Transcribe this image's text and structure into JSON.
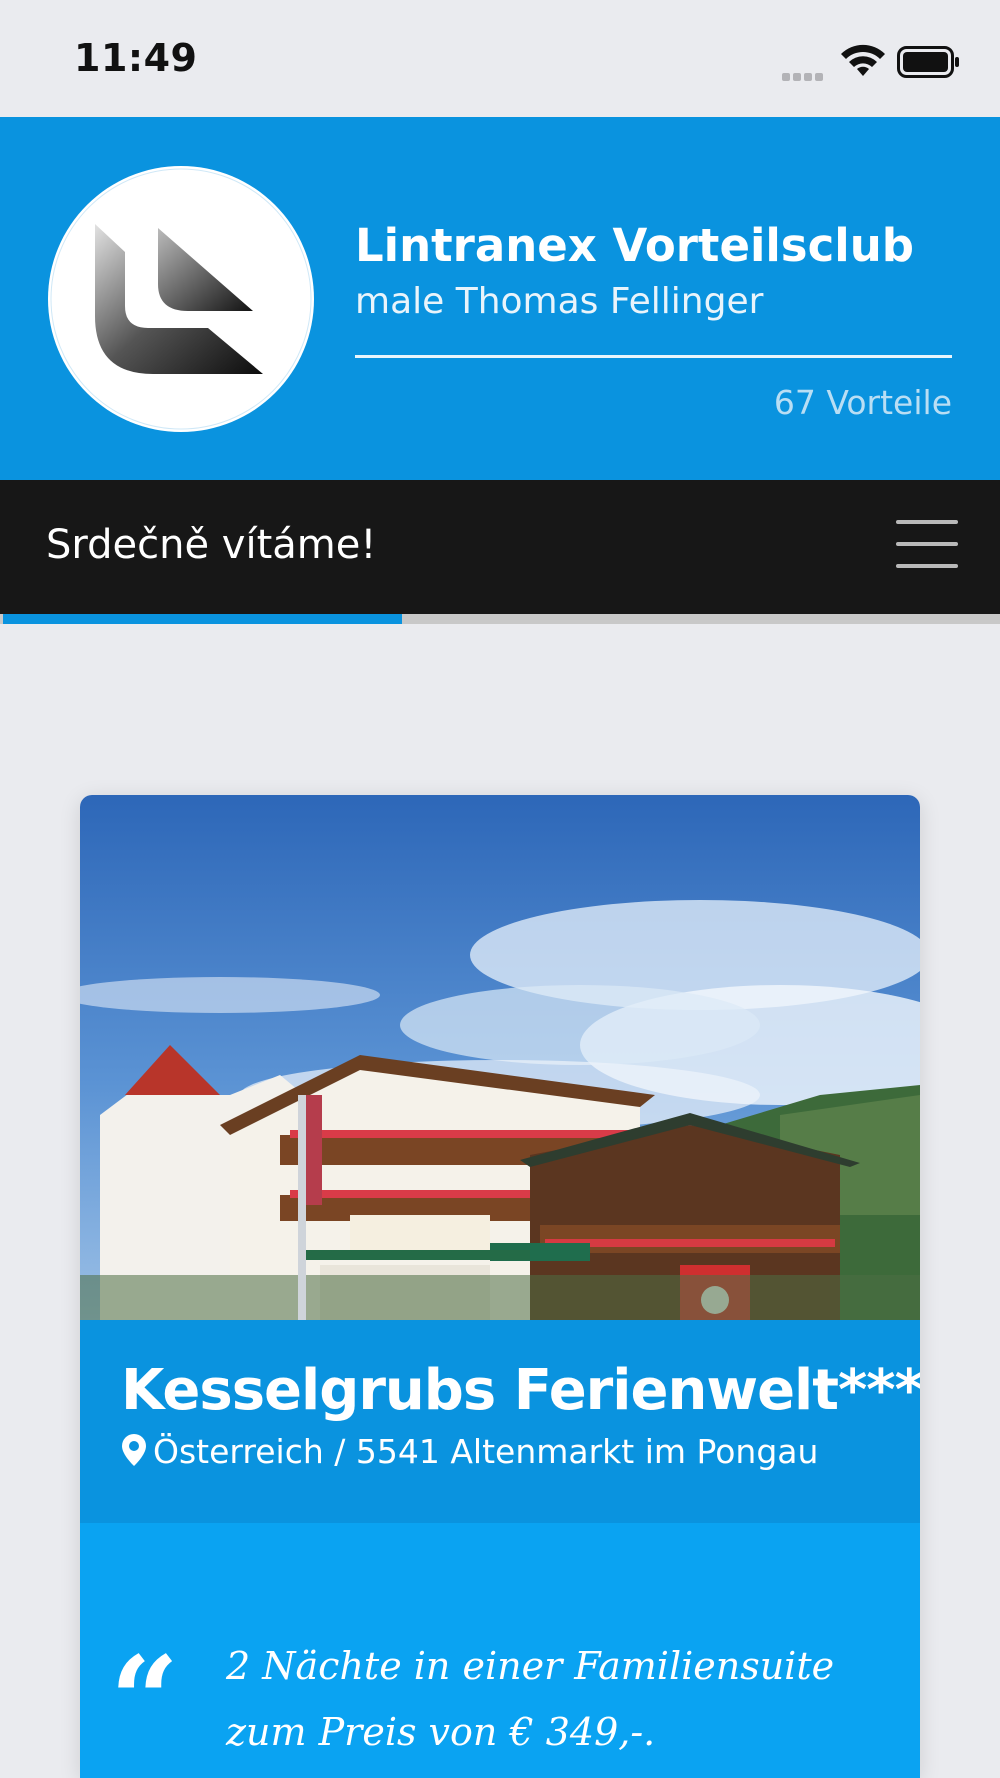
{
  "status_bar": {
    "time": "11:49"
  },
  "header": {
    "club_name": "Lintranex Vorteilsclub",
    "user_line": "male Thomas Fellinger",
    "benefits_count": "67 Vorteile",
    "accent_color": "#0a93df"
  },
  "navbar": {
    "welcome": "Srdečně vítáme!",
    "menu_icon": "hamburger-icon"
  },
  "progress": {
    "fraction": 0.4
  },
  "offer_card": {
    "image_description_icon": "hotel-photo",
    "title": "Kesselgrubs Ferienwelt****",
    "location": "Österreich / 5541 Altenmarkt im Pongau",
    "location_icon": "map-pin-icon",
    "quote_mark": "“",
    "quote_text": "2 Nächte in einer Familiensuite zum Preis von € 349,-."
  }
}
